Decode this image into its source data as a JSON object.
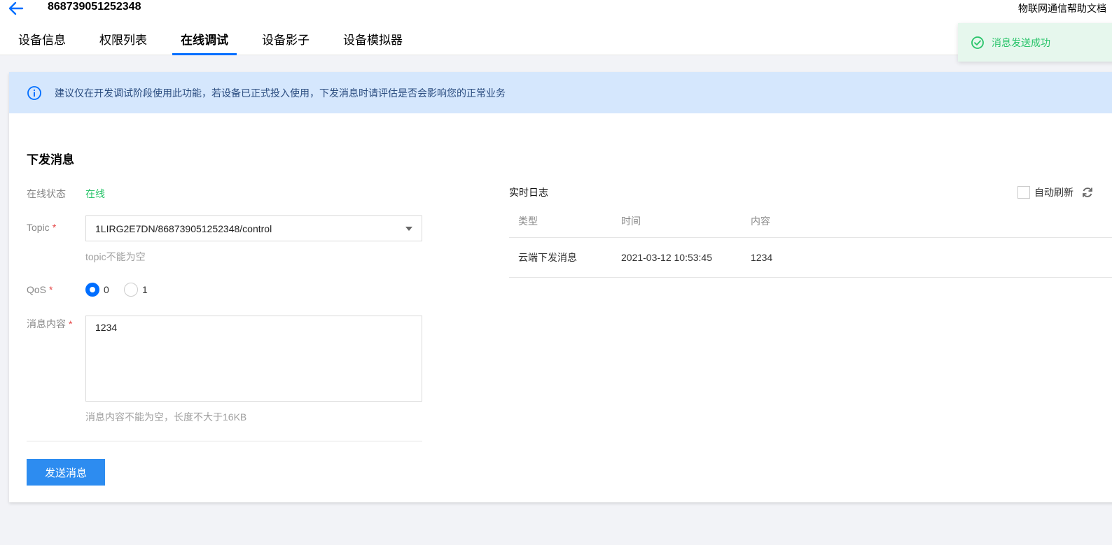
{
  "header": {
    "device_id": "868739051252348",
    "help_link": "物联网通信帮助文档"
  },
  "tabs": [
    {
      "label": "设备信息",
      "active": false
    },
    {
      "label": "权限列表",
      "active": false
    },
    {
      "label": "在线调试",
      "active": true
    },
    {
      "label": "设备影子",
      "active": false
    },
    {
      "label": "设备模拟器",
      "active": false
    }
  ],
  "toast": {
    "text": "消息发送成功",
    "color": "#29c46a"
  },
  "notice": {
    "text": "建议仅在开发调试阶段使用此功能，若设备已正式投入使用，下发消息时请评估是否会影响您的正常业务"
  },
  "form": {
    "title": "下发消息",
    "online_label": "在线状态",
    "online_value": "在线",
    "topic_label": "Topic",
    "topic_value": "1LIRG2E7DN/868739051252348/control",
    "topic_hint": "topic不能为空",
    "qos_label": "QoS",
    "qos_options": [
      "0",
      "1"
    ],
    "qos_selected": "0",
    "message_label": "消息内容",
    "message_value": "1234",
    "message_hint": "消息内容不能为空，长度不大于16KB",
    "required_mark": "*",
    "send_button": "发送消息"
  },
  "log": {
    "title": "实时日志",
    "auto_refresh_label": "自动刷新",
    "columns": [
      "类型",
      "时间",
      "内容"
    ],
    "rows": [
      {
        "type": "云端下发消息",
        "time": "2021-03-12 10:53:45",
        "content": "1234"
      }
    ]
  },
  "colors": {
    "accent": "#006eff",
    "success": "#29c46a",
    "button": "#2d8cf0"
  }
}
